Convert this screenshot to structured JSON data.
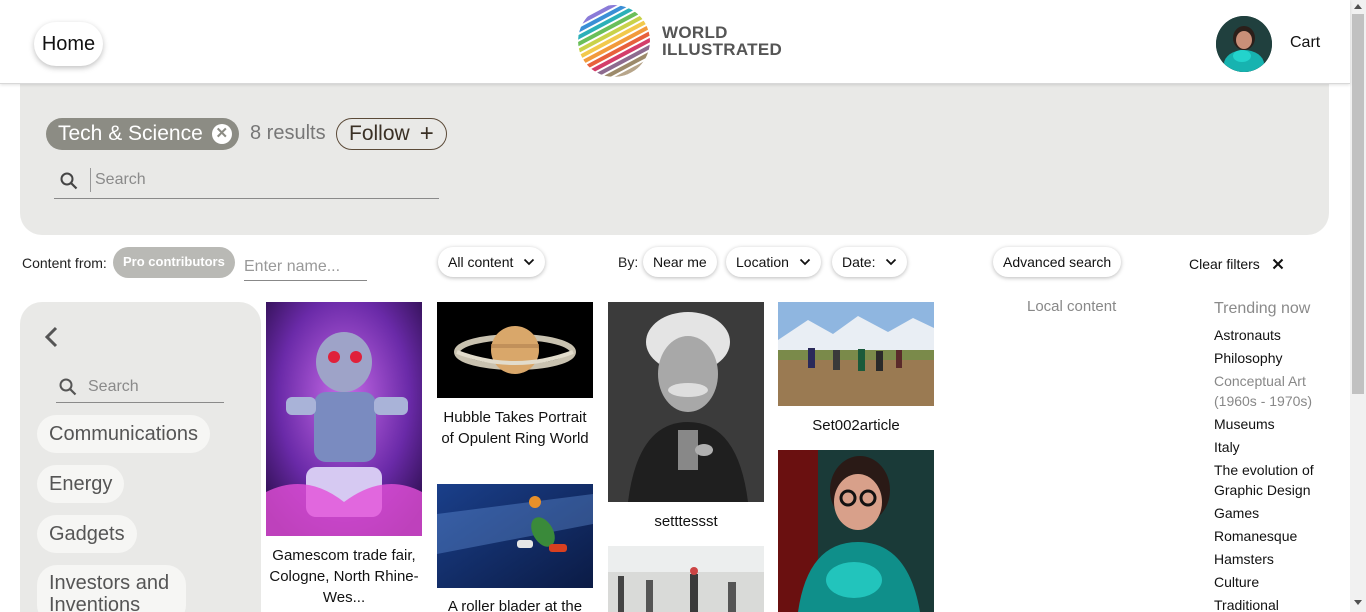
{
  "header": {
    "home_label": "Home",
    "logo_line1": "WORLD",
    "logo_line2": "ILLUSTRATED",
    "cart_label": "Cart"
  },
  "topic": {
    "name": "Tech & Science",
    "results": "8 results",
    "follow_label": "Follow",
    "search_placeholder": "Search"
  },
  "filters": {
    "content_from_label": "Content from:",
    "pro_contributors_label": "Pro contributors",
    "name_placeholder": "Enter name...",
    "all_content_label": "All content",
    "by_label": "By:",
    "near_me_label": "Near me",
    "location_label": "Location",
    "date_label": "Date:",
    "advanced_search_label": "Advanced search",
    "clear_filters_label": "Clear filters"
  },
  "sidebar": {
    "search_placeholder": "Search",
    "categories": [
      "Communications",
      "Energy",
      "Gadgets",
      "Investors and Inventions"
    ]
  },
  "grid": {
    "items": [
      {
        "caption": "Gamescom trade fair, Cologne, North Rhine-Wes..."
      },
      {
        "caption": "Hubble Takes Portrait of Opulent Ring World"
      },
      {
        "caption": "A roller blader at the"
      },
      {
        "caption": "setttessst"
      },
      {
        "caption": ""
      },
      {
        "caption": "Set002article"
      },
      {
        "caption": ""
      }
    ]
  },
  "right": {
    "local_content_label": "Local content",
    "trending_title": "Trending now",
    "trending": [
      "Astronauts",
      "Philosophy",
      "Conceptual Art (1960s - 1970s)",
      "Museums",
      "Italy",
      "The evolution of Graphic Design",
      "Games",
      "Romanesque",
      "Hamsters",
      "Culture",
      "Traditional"
    ]
  },
  "colors": {
    "panel_bg": "#e9e9e7",
    "topic_chip": "#8c8c84",
    "pro_chip": "#b9b9b5",
    "follow_border": "#5b4a38"
  }
}
